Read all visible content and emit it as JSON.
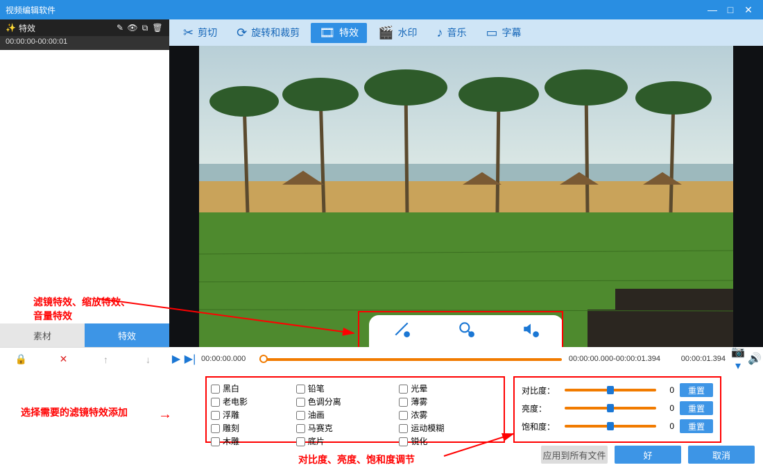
{
  "window": {
    "title": "视频编辑软件"
  },
  "leftPanel": {
    "headerLabel": "特效",
    "timeRange": "00:00:00-00:00:01",
    "tabs": {
      "material": "素材",
      "effects": "特效"
    }
  },
  "toolbar": {
    "cut": "剪切",
    "rotate": "旋转和裁剪",
    "fx": "特效",
    "watermark": "水印",
    "music": "音乐",
    "subtitle": "字幕"
  },
  "timeline": {
    "left": "00:00:00.000",
    "range": "00:00:00.000-00:00:01.394",
    "right": "00:00:01.394"
  },
  "filters": {
    "col1": [
      "黑白",
      "老电影",
      "浮雕",
      "雕刻",
      "木雕"
    ],
    "col2": [
      "铅笔",
      "色调分离",
      "油画",
      "马赛克",
      "底片"
    ],
    "col3": [
      "光晕",
      "薄雾",
      "浓雾",
      "运动模糊",
      "锐化"
    ]
  },
  "sliders": {
    "contrast": {
      "label": "对比度：",
      "value": "0",
      "reset": "重置"
    },
    "brightness": {
      "label": "亮度：",
      "value": "0",
      "reset": "重置"
    },
    "saturation": {
      "label": "饱和度：",
      "value": "0",
      "reset": "重置"
    }
  },
  "annotations": {
    "a1_line1": "滤镜特效、缩放特效、",
    "a1_line2": "音量特效",
    "a2": "选择需要的滤镜特效添加",
    "a3": "对比度、亮度、饱和度调节"
  },
  "buttons": {
    "applyAll": "应用到所有文件",
    "ok": "好",
    "cancel": "取消"
  }
}
